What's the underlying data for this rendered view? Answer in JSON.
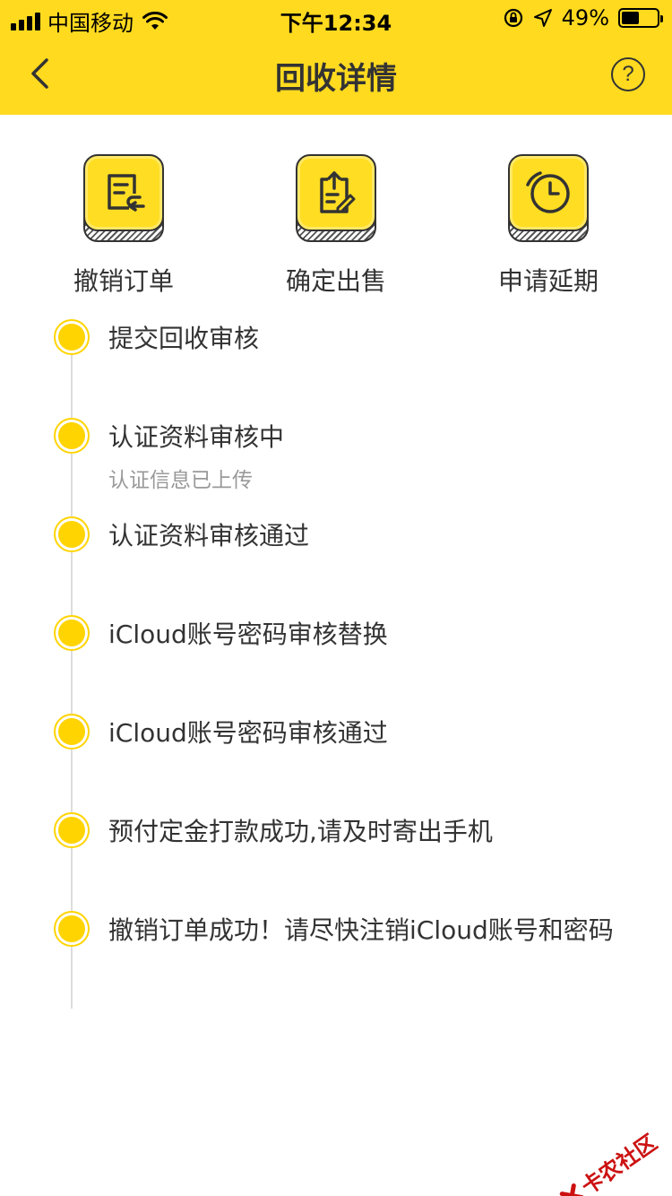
{
  "status_bar": {
    "carrier": "中国移动",
    "time": "下午12:34",
    "battery_percent_text": "49%",
    "battery_level": 0.49
  },
  "nav": {
    "title": "回收详情",
    "help_glyph": "?"
  },
  "actions": [
    {
      "label": "撤销订单",
      "icon": "document-undo-icon"
    },
    {
      "label": "确定出售",
      "icon": "clipboard-upload-icon"
    },
    {
      "label": "申请延期",
      "icon": "clock-icon"
    }
  ],
  "timeline": [
    {
      "title": "提交回收审核",
      "subtitle": ""
    },
    {
      "title": "认证资料审核中",
      "subtitle": "认证信息已上传"
    },
    {
      "title": "认证资料审核通过",
      "subtitle": ""
    },
    {
      "title": "iCloud账号密码审核替换",
      "subtitle": ""
    },
    {
      "title": "iCloud账号密码审核通过",
      "subtitle": ""
    },
    {
      "title": "预付定金打款成功,请及时寄出手机",
      "subtitle": ""
    },
    {
      "title": "撤销订单成功！请尽快注销iCloud账号和密码",
      "subtitle": ""
    }
  ],
  "watermark": {
    "text": "卡农社区"
  },
  "colors": {
    "brand_yellow": "#FFDA1F",
    "dot_yellow": "#FFD400",
    "text_dark": "#333333",
    "text_muted": "#999999"
  }
}
